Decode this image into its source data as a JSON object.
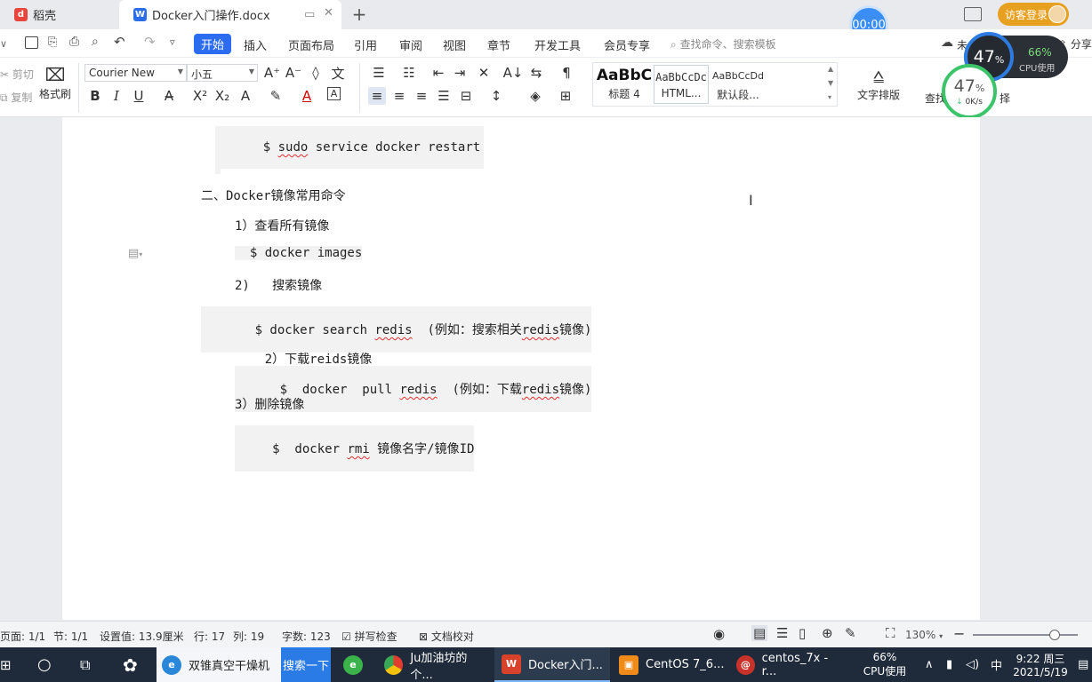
{
  "titlebar": {
    "tab1_label": "稻壳",
    "tab2_label": "Docker入门操作.docx",
    "login_label": "访客登录",
    "timer": "00:00"
  },
  "menu": {
    "items": [
      "开始",
      "插入",
      "页面布局",
      "引用",
      "审阅",
      "视图",
      "章节",
      "开发工具",
      "会员专享"
    ],
    "search_placeholder": "查找命令、搜索模板",
    "share_label": "分享",
    "unsync_label": "未"
  },
  "ribbon": {
    "cut": "剪切",
    "copy": "复制",
    "format_painter": "格式刷",
    "font_name": "Courier New",
    "font_size": "小五",
    "styles": [
      {
        "preview": "AaBbC",
        "label": "标题 4"
      },
      {
        "preview": "AaBbCcDc",
        "label": "HTML..."
      },
      {
        "preview": "AaBbCcDd",
        "label": "默认段..."
      }
    ],
    "text_layout": "文字排版",
    "find": "查找",
    "select": "择"
  },
  "cpu": {
    "big": "47",
    "big_unit": "%",
    "small": "66%",
    "small_label": "CPU使用",
    "ring_value": "47",
    "ring_unit": "%",
    "net": "0K/s"
  },
  "document": {
    "line1_dollar": "$",
    "line1_sudo": "sudo",
    "line1_rest": " service docker restart",
    "h2": "二、Docker镜像常用命令",
    "i1": "1）查看所有镜像",
    "i1_cmd": "  $ docker images",
    "i2": "2)   搜索镜像",
    "i2_cmd_a": "  $ docker search ",
    "i2_cmd_redis": "redis",
    "i2_cmd_b": "  (例如：搜索相关",
    "i2_cmd_redis2": "redis",
    "i2_cmd_c": "镜像)",
    "i3_a": "2）下载",
    "i3_reids": "reids",
    "i3_b": "镜像",
    "i3_cmd_a": "  $  docker  pull ",
    "i3_cmd_redis": "redis",
    "i3_cmd_b": "  (例如：下载",
    "i3_cmd_redis2": "redis",
    "i3_cmd_c": "镜像)",
    "i4": "3）删除镜像",
    "i4_cmd_a": " $  docker ",
    "i4_cmd_rmi": "rmi",
    "i4_cmd_b": " 镜像名字/镜像ID"
  },
  "status": {
    "page": "页面: 1/1",
    "section": "节: 1/1",
    "setting": "设置值: 13.9厘米",
    "row": "行: 17",
    "col": "列: 19",
    "words": "字数: 123",
    "spell": "拼写检查",
    "proof": "文档校对",
    "zoom": "130%",
    "zoom_level": 0.78
  },
  "taskbar": {
    "app1": "双锥真空干燥机",
    "search_btn": "搜索一下",
    "app2": "Ju加油坊的个...",
    "app3": "Docker入门...",
    "app4": "CentOS 7_6...",
    "app5": "centos_7x - r...",
    "cpu_pct": "66%",
    "cpu_label": "CPU使用",
    "time": "9:22 周三",
    "date": "2021/5/19"
  },
  "colors": {
    "accent": "#2c6cf0",
    "taskbar": "#1f2b3a",
    "squiggle": "#e03131"
  }
}
